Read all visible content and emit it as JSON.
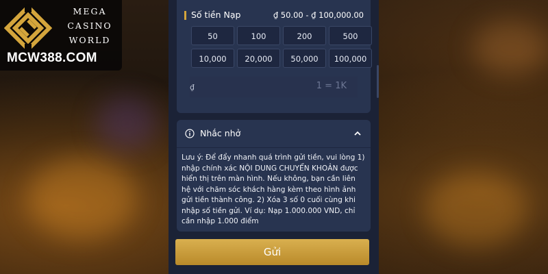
{
  "logo": {
    "line1": "MEGA",
    "line2": "CASINO",
    "line3": "WORLD",
    "url": "MCW388.COM"
  },
  "amount": {
    "title": "Số tiền Nạp",
    "range": "₫ 50.00 - ₫ 100,000.00",
    "chips": [
      "50",
      "100",
      "200",
      "500",
      "10,000",
      "20,000",
      "50,000",
      "100,000"
    ],
    "currency": "₫",
    "unit_hint": "1 = 1K"
  },
  "reminder": {
    "title": "Nhắc nhở",
    "text": "Lưu ý: Để đẩy nhanh quá trình gửi tiền, vui lòng 1) nhập chính xác NỘI DUNG CHUYỂN KHOẢN được hiển thị trên màn hình. Nếu không, bạn cần liên hệ với chăm sóc khách hàng kèm theo hình ảnh gửi tiền thành công. 2) Xóa 3 số 0 cuối cùng khi nhập số tiền gửi. Ví dụ: Nạp 1.000.000 VND, chỉ cần nhập 1.000 điểm"
  },
  "submit_label": "Gửi",
  "colors": {
    "panel_bg": "#1b2236",
    "card_bg": "#283450",
    "accent_gold": "#d4a53c"
  }
}
